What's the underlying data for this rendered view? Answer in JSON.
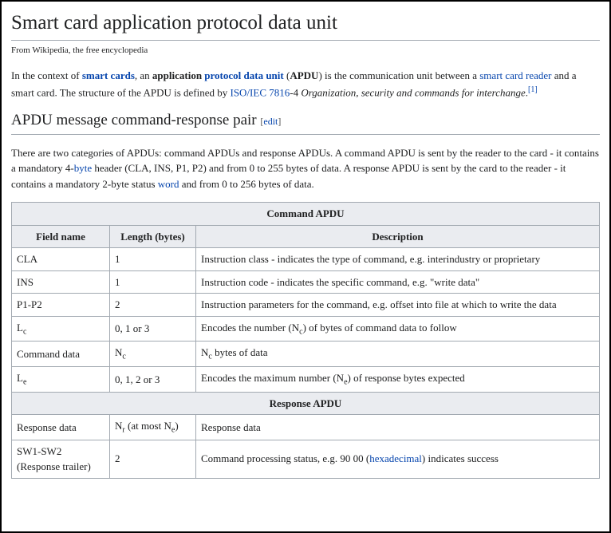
{
  "title": "Smart card application protocol data unit",
  "tagline": "From Wikipedia, the free encyclopedia",
  "intro": {
    "p1_pre": "In the context of ",
    "p1_link1": "smart cards",
    "p1_mid1": ", an ",
    "p1_bold": "application ",
    "p1_link2": "protocol data unit",
    "p1_mid2": " (",
    "p1_bold2": "APDU",
    "p1_mid3": ") is the communication unit between a ",
    "p1_link3": "smart card reader",
    "p1_mid4": " and a smart card. The structure of the APDU is defined by ",
    "p1_link4": "ISO/IEC 7816",
    "p1_mid5": "-4 ",
    "p1_ital": "Organization, security and commands for interchange",
    "p1_end": ".",
    "p1_ref": "[1]"
  },
  "section_heading": "APDU message command-response pair",
  "edit_open": "[",
  "edit_label": "edit",
  "edit_close": "]",
  "p2": {
    "pre": "There are two categories of APDUs: command APDUs and response APDUs. A command APDU is sent by the reader to the card - it contains a mandatory 4-",
    "link1": "byte",
    "mid": " header (CLA, INS, P1, P2) and from 0 to 255 bytes of data. A response APDU is sent by the card to the reader - it contains a mandatory 2-byte status ",
    "link2": "word",
    "end": " and from 0 to 256 bytes of data."
  },
  "table": {
    "header_cmd": "Command APDU",
    "col_field": "Field name",
    "col_len": "Length (bytes)",
    "col_desc": "Description",
    "rows_cmd": [
      {
        "field": "CLA",
        "len": "1",
        "desc": "Instruction class - indicates the type of command, e.g. interindustry or proprietary"
      },
      {
        "field": "INS",
        "len": "1",
        "desc": "Instruction code - indicates the specific command, e.g. \"write data\""
      },
      {
        "field": "P1-P2",
        "len": "2",
        "desc": "Instruction parameters for the command, e.g. offset into file at which to write the data"
      }
    ],
    "lc_field_pre": "L",
    "lc_field_sub": "c",
    "lc_len": "0, 1 or 3",
    "lc_desc_pre": "Encodes the number (N",
    "lc_desc_sub": "c",
    "lc_desc_post": ") of bytes of command data to follow",
    "cd_field": "Command data",
    "cd_len_pre": "N",
    "cd_len_sub": "c",
    "cd_desc_pre": "N",
    "cd_desc_sub": "c",
    "cd_desc_post": " bytes of data",
    "le_field_pre": "L",
    "le_field_sub": "e",
    "le_len": "0, 1, 2 or 3",
    "le_desc_pre": "Encodes the maximum number (N",
    "le_desc_sub": "e",
    "le_desc_post": ") of response bytes expected",
    "header_resp": "Response APDU",
    "rd_field": "Response data",
    "rd_len_pre": "N",
    "rd_len_sub": "r",
    "rd_len_mid": " (at most N",
    "rd_len_sub2": "e",
    "rd_len_post": ")",
    "rd_desc": "Response data",
    "sw_field": "SW1-SW2 (Response trailer)",
    "sw_len": "2",
    "sw_desc_pre": "Command processing status, e.g. 90 00 (",
    "sw_link": "hexadecimal",
    "sw_desc_post": ") indicates success"
  }
}
